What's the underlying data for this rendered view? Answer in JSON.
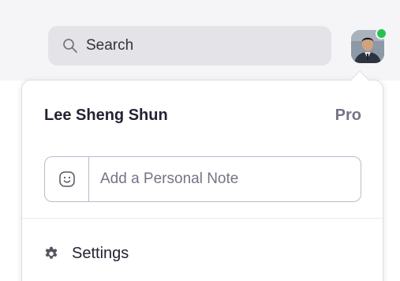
{
  "header": {
    "search": {
      "label": "Search",
      "icon": "search-icon"
    },
    "avatar": {
      "status": "online",
      "status_color": "#26c250"
    }
  },
  "profile_menu": {
    "user_name": "Lee Sheng Shun",
    "plan": "Pro",
    "personal_note": {
      "value": "",
      "placeholder": "Add a Personal Note",
      "emoji_icon": "smiley-icon"
    },
    "items": [
      {
        "label": "Settings",
        "icon": "gear-icon"
      }
    ]
  }
}
